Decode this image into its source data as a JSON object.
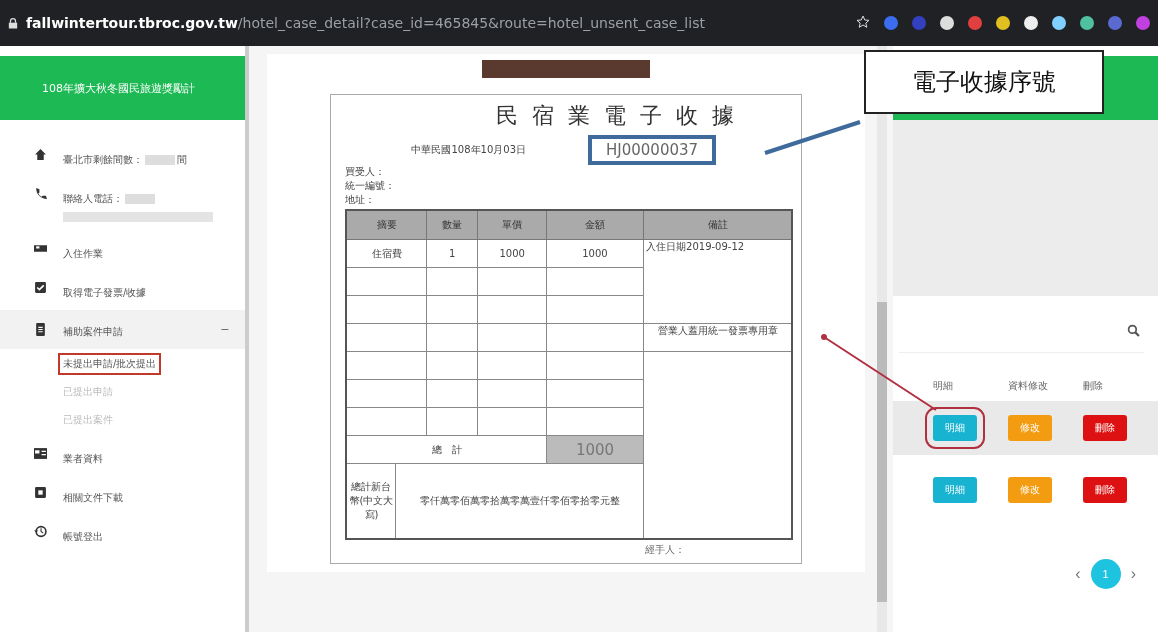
{
  "browser": {
    "url_host": "fallwintertour.tbroc.gov.tw",
    "url_path": "/hotel_case_detail?case_id=465845&route=hotel_unsent_case_list"
  },
  "sidebar": {
    "header": "108年擴大秋冬國民旅遊獎勵計",
    "items": [
      {
        "label": "臺北市剩餘間數：",
        "suffix": "間",
        "redacted": true,
        "expanded": false
      },
      {
        "label": "聯絡人電話：",
        "redacted": true,
        "expanded": false
      },
      {
        "label": "入住作業",
        "expanded": false
      },
      {
        "label": "取得電子發票/收據",
        "expanded": false
      },
      {
        "label": "補助案件申請",
        "toggle": "−",
        "expanded": true,
        "children": [
          {
            "label": "未提出申請/批次提出",
            "selected": true
          },
          {
            "label": "已提出申請",
            "selected": false
          },
          {
            "label": "已提出案件",
            "selected": false
          }
        ]
      },
      {
        "label": "業者資料",
        "expanded": false
      },
      {
        "label": "相關文件下載",
        "expanded": false
      },
      {
        "label": "帳號登出",
        "expanded": false
      }
    ]
  },
  "receipt": {
    "title": "民宿業電子收據",
    "date": "中華民國108年10月03日",
    "number": "HJ00000037",
    "fields": [
      "買受人：",
      "統一編號：",
      "地址："
    ],
    "columns": [
      "摘要",
      "數量",
      "單價",
      "金額",
      "備註"
    ],
    "rows": [
      [
        "住宿費",
        "1",
        "1000",
        "1000"
      ],
      [
        "",
        "",
        "",
        ""
      ],
      [
        "",
        "",
        "",
        ""
      ],
      [
        "",
        "",
        "",
        ""
      ],
      [
        "",
        "",
        "",
        ""
      ],
      [
        "",
        "",
        "",
        ""
      ],
      [
        "",
        "",
        "",
        ""
      ]
    ],
    "notes": [
      "入住日期2019-09-12",
      "營業人蓋用統一發票專用章"
    ],
    "total_label": "總　計",
    "total": "1000",
    "amount_label": "總計新台幣(中文大寫)",
    "amount_words": "零仟萬零佰萬零拾萬零萬壹仟零佰零拾零元整",
    "handler": "經手人："
  },
  "callout": "電子收據序號",
  "list": {
    "columns": [
      "明細",
      "資料修改",
      "刪除"
    ],
    "rows": [
      {
        "selected": true,
        "buttons": [
          {
            "kind": "detail",
            "label": "明細"
          },
          {
            "kind": "edit",
            "label": "修改"
          },
          {
            "kind": "delete",
            "label": "刪除"
          }
        ]
      },
      {
        "selected": false,
        "buttons": [
          {
            "kind": "detail",
            "label": "明細"
          },
          {
            "kind": "edit",
            "label": "修改"
          },
          {
            "kind": "delete",
            "label": "刪除"
          }
        ]
      }
    ],
    "pages": [
      {
        "label": "1",
        "selected": true
      }
    ],
    "prev": "‹",
    "next": "›"
  }
}
